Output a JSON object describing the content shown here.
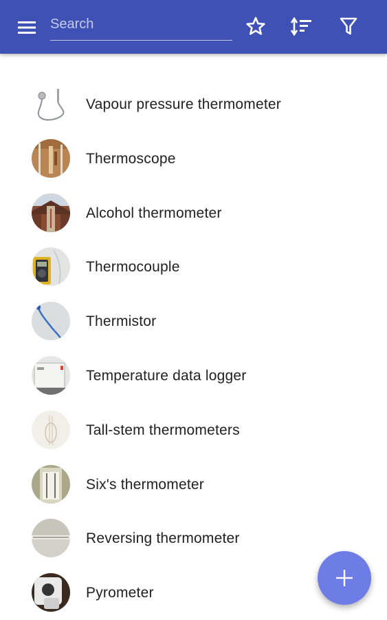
{
  "colors": {
    "app_bar": "#3f51b5",
    "fab": "#6e7ce6",
    "text": "#212121"
  },
  "toolbar": {
    "menu_icon": "menu-icon",
    "search_placeholder": "Search",
    "favorites_icon": "star-outline-icon",
    "sort_icon": "sort-icon",
    "filter_icon": "filter-icon"
  },
  "items": [
    {
      "label": "Vapour pressure thermometer",
      "thumbnail": "vapour-pressure-thermometer-photo"
    },
    {
      "label": "Thermoscope",
      "thumbnail": "thermoscope-photo"
    },
    {
      "label": "Alcohol thermometer",
      "thumbnail": "alcohol-thermometer-photo"
    },
    {
      "label": "Thermocouple",
      "thumbnail": "thermocouple-photo"
    },
    {
      "label": "Thermistor",
      "thumbnail": "thermistor-photo"
    },
    {
      "label": "Temperature data logger",
      "thumbnail": "temperature-data-logger-photo"
    },
    {
      "label": "Tall-stem thermometers",
      "thumbnail": "tall-stem-thermometers-photo"
    },
    {
      "label": "Six's thermometer",
      "thumbnail": "sixs-thermometer-photo"
    },
    {
      "label": "Reversing thermometer",
      "thumbnail": "reversing-thermometer-photo"
    },
    {
      "label": "Pyrometer",
      "thumbnail": "pyrometer-photo"
    }
  ],
  "fab": {
    "icon": "plus-icon"
  }
}
